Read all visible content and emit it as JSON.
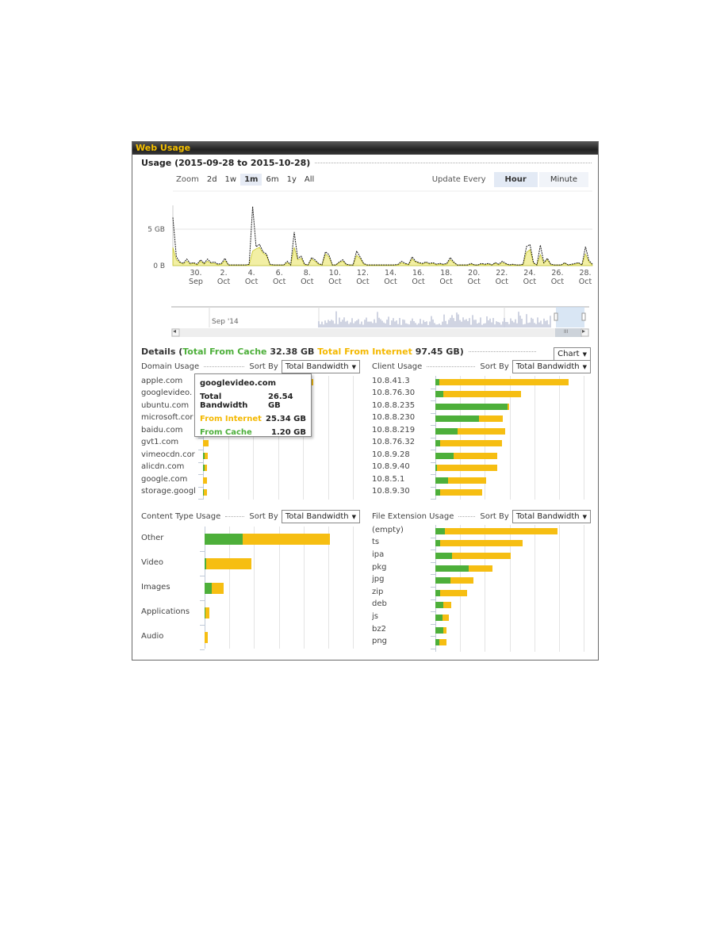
{
  "panel": {
    "title": "Web Usage",
    "usage_title": "Usage (2015-09-28 to 2015-10-28)"
  },
  "zoom": {
    "label": "Zoom",
    "options": [
      "2d",
      "1w",
      "1m",
      "6m",
      "1y",
      "All"
    ],
    "active": "1m"
  },
  "update": {
    "label": "Update Every",
    "options": [
      "Hour",
      "Minute"
    ],
    "active": "Hour"
  },
  "navigator": {
    "label": "Sep '14",
    "scroll_left": "◂",
    "scroll_right": "▸",
    "scroll_grip": "III"
  },
  "colors": {
    "cache": "#4daf3a",
    "internet": "#f6be12",
    "line": "#1a1a1a"
  },
  "details": {
    "label": "Details",
    "cache_label": "Total From Cache",
    "cache_value": "32.38 GB",
    "internet_label": "Total From Internet",
    "internet_value": "97.45 GB",
    "view_select": "Chart"
  },
  "sort_by_label": "Sort By",
  "sort_value": "Total Bandwidth",
  "tooltip": {
    "title": "googlevideo.com",
    "rows": [
      {
        "label": "Total Bandwidth",
        "value": "26.54 GB"
      },
      {
        "label": "From Internet",
        "value": "25.34 GB"
      },
      {
        "label": "From Cache",
        "value": "1.20 GB"
      }
    ]
  },
  "chart_data": [
    {
      "type": "area",
      "title": "Usage (2015-09-28 to 2015-10-28)",
      "xlabel": "",
      "ylabel": "",
      "x_ticks": [
        "30. Sep",
        "2. Oct",
        "4. Oct",
        "6. Oct",
        "8. Oct",
        "10. Oct",
        "12. Oct",
        "14. Oct",
        "16. Oct",
        "18. Oct",
        "20. Oct",
        "22. Oct",
        "24. Oct",
        "26. Oct",
        "28. Oct"
      ],
      "y_ticks": [
        "0 B",
        "5 GB"
      ],
      "ylim_gb": [
        0,
        10
      ],
      "grid": true,
      "series": [
        {
          "name": "Total",
          "style": "dashed-dark",
          "values_gb": [
            6.6,
            1.2,
            0.5,
            0.3,
            0.9,
            0.3,
            0.4,
            0.2,
            0.8,
            0.3,
            0.9,
            0.4,
            0.5,
            0.2,
            0.3,
            1.0,
            0.1,
            0.1,
            0.1,
            0.1,
            0.1,
            0.1,
            0.2,
            8.1,
            2.6,
            2.9,
            1.9,
            1.6,
            0.2,
            0.1,
            0.1,
            0.1,
            0.1,
            0.6,
            0.1,
            4.6,
            1.0,
            1.3,
            0.2,
            0.1,
            1.1,
            0.8,
            0.3,
            0.1,
            1.9,
            1.5,
            0.1,
            0.1,
            0.5,
            0.8,
            0.2,
            0.1,
            0.1,
            2.0,
            1.2,
            0.3,
            0.1,
            0.1,
            0.1,
            0.1,
            0.1,
            0.1,
            0.1,
            0.1,
            0.1,
            0.2,
            0.6,
            0.3,
            0.2,
            1.2,
            0.6,
            0.4,
            0.3,
            0.5,
            0.3,
            0.4,
            0.2,
            0.3,
            0.2,
            0.3,
            1.1,
            0.5,
            0.1,
            0.1,
            0.1,
            0.1,
            0.3,
            0.1,
            0.1,
            0.3,
            0.2,
            0.3,
            0.1,
            0.4,
            0.2,
            0.6,
            0.3,
            0.1,
            0.2,
            0.1,
            0.1,
            0.2,
            2.6,
            2.9,
            0.4,
            0.1,
            2.8,
            0.4,
            1.0,
            0.2,
            0.1,
            0.1,
            0.1,
            0.4,
            0.1,
            0.2,
            0.3,
            0.4,
            0.1,
            2.6,
            0.7,
            0.2
          ]
        },
        {
          "name": "From Internet",
          "style": "yellow-area",
          "values_gb": [
            2.5,
            0.8,
            0.4,
            0.2,
            0.6,
            0.2,
            0.3,
            0.1,
            0.6,
            0.2,
            0.6,
            0.3,
            0.3,
            0.1,
            0.2,
            0.7,
            0.1,
            0.1,
            0.1,
            0.1,
            0.1,
            0.1,
            0.1,
            2.0,
            2.3,
            2.5,
            1.7,
            1.4,
            0.1,
            0.1,
            0.1,
            0.1,
            0.1,
            0.4,
            0.1,
            2.5,
            0.8,
            1.0,
            0.1,
            0.1,
            0.9,
            0.6,
            0.2,
            0.1,
            1.6,
            1.2,
            0.1,
            0.1,
            0.4,
            0.6,
            0.1,
            0.1,
            0.1,
            1.4,
            1.0,
            0.2,
            0.1,
            0.1,
            0.1,
            0.1,
            0.1,
            0.1,
            0.1,
            0.1,
            0.1,
            0.1,
            0.4,
            0.2,
            0.1,
            0.9,
            0.5,
            0.3,
            0.2,
            0.4,
            0.2,
            0.3,
            0.1,
            0.2,
            0.1,
            0.2,
            0.8,
            0.4,
            0.1,
            0.1,
            0.1,
            0.1,
            0.2,
            0.1,
            0.1,
            0.2,
            0.1,
            0.2,
            0.1,
            0.3,
            0.1,
            0.4,
            0.2,
            0.1,
            0.1,
            0.1,
            0.1,
            0.1,
            1.8,
            2.2,
            0.3,
            0.1,
            1.5,
            0.3,
            0.8,
            0.1,
            0.1,
            0.1,
            0.1,
            0.3,
            0.1,
            0.1,
            0.2,
            0.3,
            0.1,
            1.6,
            0.5,
            0.1
          ]
        }
      ]
    },
    {
      "type": "bar",
      "title": "Domain Usage",
      "stacked": true,
      "categories": [
        "apple.com",
        "googlevideo.com",
        "ubuntu.com",
        "microsoft.com",
        "baidu.com",
        "gvt1.com",
        "vimeocdn.com",
        "alicdn.com",
        "google.com",
        "storage.googleapis.com"
      ],
      "category_labels": [
        "apple.com",
        "googlevideo.",
        "ubuntu.com",
        "microsoft.cor",
        "baidu.com",
        "gvt1.com",
        "vimeocdn.cor",
        "alicdn.com",
        "google.com",
        "storage.googl"
      ],
      "series": [
        {
          "name": "From Cache",
          "values": [
            0.5,
            1.2,
            0.3,
            0.3,
            0.3,
            0.1,
            0.4,
            0.4,
            0.1,
            0.2
          ]
        },
        {
          "name": "From Internet",
          "values": [
            32.5,
            25.34,
            8,
            6,
            5,
            1.6,
            1.0,
            0.8,
            1.0,
            1.1
          ]
        }
      ],
      "xlim": [
        0,
        45
      ]
    },
    {
      "type": "bar",
      "title": "Client Usage",
      "stacked": true,
      "categories": [
        "10.8.41.3",
        "10.8.76.30",
        "10.8.8.235",
        "10.8.8.219",
        "10.8.8.230",
        "10.8.76.32",
        "10.8.9.28",
        "10.8.9.40",
        "10.8.5.1",
        "10.8.9.30"
      ],
      "series": [
        {
          "name": "From Cache",
          "values": [
            0.5,
            1.0,
            8.8,
            2.7,
            5.3,
            0.6,
            2.2,
            0.2,
            1.5,
            0.6
          ]
        },
        {
          "name": "From Internet",
          "values": [
            15.7,
            9.4,
            0.2,
            5.8,
            2.9,
            7.5,
            5.3,
            7.3,
            4.7,
            5.1
          ]
        }
      ],
      "category_order_display": [
        "10.8.41.3",
        "10.8.76.30",
        "10.8.8.235",
        "10.8.8.230",
        "10.8.8.219",
        "10.8.76.32",
        "10.8.9.28",
        "10.8.9.40",
        "10.8.5.1",
        "10.8.9.30"
      ],
      "xlim": [
        0,
        18
      ]
    },
    {
      "type": "bar",
      "title": "Content Type Usage",
      "stacked": true,
      "categories": [
        "Other",
        "Video",
        "Images",
        "Applications",
        "Audio"
      ],
      "series": [
        {
          "name": "From Cache",
          "values": [
            22,
            0.8,
            4.2,
            0.3,
            0.2
          ]
        },
        {
          "name": "From Internet",
          "values": [
            50,
            26,
            6.8,
            2.5,
            1.8
          ]
        }
      ],
      "xlim": [
        0,
        85
      ]
    },
    {
      "type": "bar",
      "title": "File Extension Usage",
      "stacked": true,
      "categories": [
        "(empty)",
        "ts",
        "ipa",
        "pkg",
        "jpg",
        "zip",
        "deb",
        "js",
        "bz2",
        "png"
      ],
      "series": [
        {
          "name": "From Cache",
          "values": [
            2.2,
            1.1,
            4.0,
            7.9,
            3.5,
            1.2,
            1.9,
            1.6,
            1.9,
            1.0
          ]
        },
        {
          "name": "From Internet",
          "values": [
            26.6,
            19.5,
            13.8,
            5.6,
            5.5,
            6.2,
            1.8,
            1.5,
            0.8,
            1.6
          ]
        }
      ],
      "xlim": [
        0,
        35
      ]
    }
  ]
}
